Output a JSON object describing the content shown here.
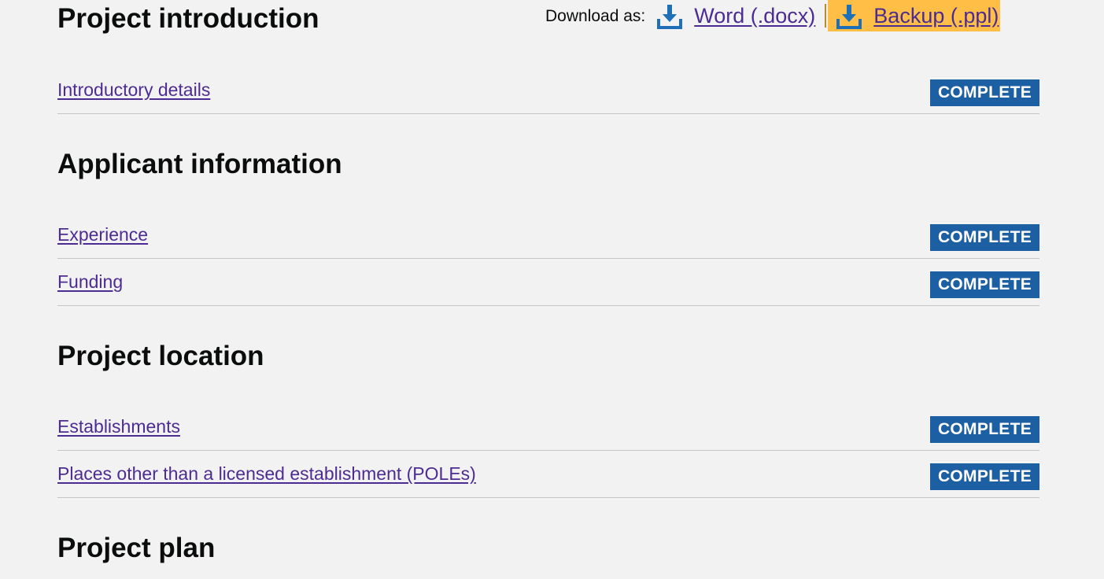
{
  "download": {
    "label": "Download as:",
    "word_label": "Word (.docx)",
    "backup_label": "Backup (.ppl)"
  },
  "sections": [
    {
      "heading": "Project introduction",
      "tasks": [
        {
          "label": "Introductory details",
          "status": "COMPLETE"
        }
      ]
    },
    {
      "heading": "Applicant information",
      "tasks": [
        {
          "label": "Experience",
          "status": "COMPLETE"
        },
        {
          "label": "Funding",
          "status": "COMPLETE"
        }
      ]
    },
    {
      "heading": "Project location",
      "tasks": [
        {
          "label": "Establishments",
          "status": "COMPLETE"
        },
        {
          "label": "Places other than a licensed establishment (POLEs)",
          "status": "COMPLETE"
        }
      ]
    },
    {
      "heading": "Project plan",
      "tasks": []
    }
  ],
  "colors": {
    "link": "#4c2c92",
    "tag_background": "#1d5fa3",
    "focus": "#ffbf47",
    "icon": "#1d70b8"
  },
  "icons": {
    "download": "download-icon"
  }
}
